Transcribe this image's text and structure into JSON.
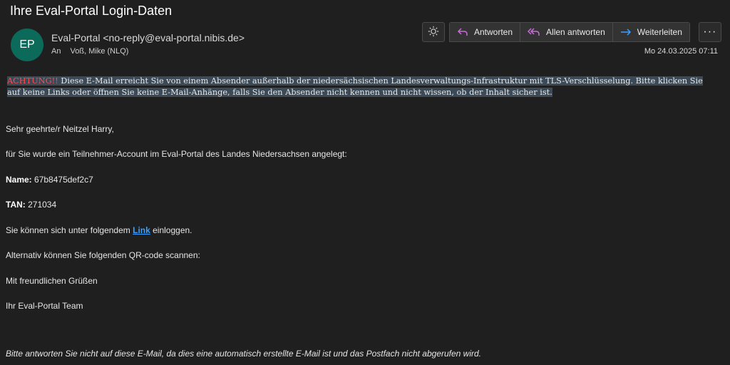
{
  "email": {
    "subject": "Ihre Eval-Portal Login-Daten",
    "avatar_initials": "EP",
    "sender": "Eval-Portal <no-reply@eval-portal.nibis.de>",
    "to_label": "An",
    "to": "Voß, Mike (NLQ)",
    "date": "Mo 24.03.2025 07:11"
  },
  "toolbar": {
    "brightness_icon": "sun-icon",
    "reply_label": "Antworten",
    "reply_all_label": "Allen antworten",
    "forward_label": "Weiterleiten",
    "more_label": "···"
  },
  "warning": {
    "alert": "ACHTUNG!!",
    "text": " Diese E-Mail erreicht Sie von einem Absender außerhalb der niedersächsischen Landesverwaltungs-Infrastruktur mit TLS-Verschlüsselung. Bitte klicken Sie auf keine Links oder öffnen Sie keine E-Mail-Anhänge, falls Sie den Absender nicht kennen und nicht wissen, ob der Inhalt sicher ist."
  },
  "body": {
    "greeting": "Sehr geehrte/r Neitzel Harry,",
    "intro": "für Sie wurde ein Teilnehmer-Account im Eval-Portal des Landes Niedersachsen angelegt:",
    "name_label": "Name:",
    "name_value": " 67b8475def2c7",
    "tan_label": "TAN:",
    "tan_value": " 271034",
    "login_prefix": "Sie können sich unter folgendem ",
    "login_link": "Link",
    "login_suffix": " einloggen.",
    "qr_text": "Alternativ können Sie folgenden QR-code scannen:",
    "closing": "Mit freundlichen Grüßen",
    "signature": "Ihr Eval-Portal Team",
    "footer": "Bitte antworten Sie nicht auf diese E-Mail, da dies eine automatisch erstellte E-Mail ist und das Postfach nicht abgerufen wird."
  },
  "colors": {
    "background": "#1f1f1f",
    "avatar": "#0b6a5a",
    "alert": "#ff4d4d",
    "link": "#3aa0ff",
    "reply_icon": "#c86dd7",
    "forward_icon": "#3aa0ff"
  }
}
